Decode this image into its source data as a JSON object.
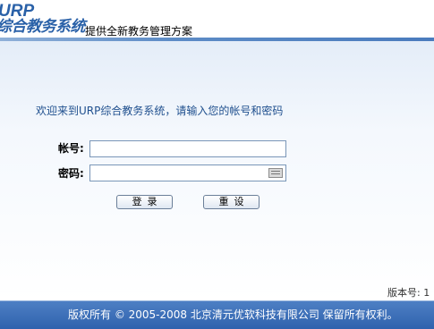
{
  "header": {
    "logo_top": "URP",
    "logo_bottom": "综合教务系统",
    "tagline": "提供全新教务管理方案"
  },
  "login": {
    "welcome": "欢迎来到URP综合教务系统，请输入您的帐号和密码",
    "account_label": "帐号:",
    "account_value": "",
    "password_label": "密码:",
    "password_value": "",
    "keyboard_icon": "keyboard-icon",
    "login_button": "登录",
    "reset_button": "重设"
  },
  "version": "版本号: 1",
  "footer": {
    "copyright": "版权所有 © 2005-2008 北京清元优软科技有限公司 保留所有权利。"
  },
  "colors": {
    "brand": "#2a61a8",
    "footer_bg": "#3a6db5",
    "welcome_text": "#1f4f8e"
  }
}
